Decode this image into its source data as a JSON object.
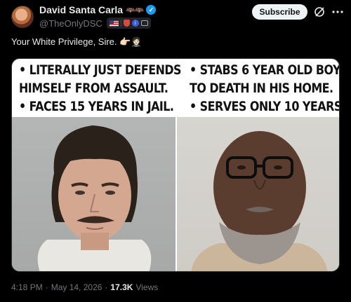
{
  "author": {
    "display_name": "David Santa Carla",
    "name_emoji": "🦇🦇",
    "handle": "@TheOnlyDSC"
  },
  "header": {
    "subscribe_label": "Subscribe",
    "grok_icon": "grok-icon",
    "more_icon": "more-icon"
  },
  "tweet": {
    "text": "Your White Privilege, Sire. 👉🏻🤵🏻"
  },
  "media": {
    "left_caption": [
      "• LITERALLY JUST DEFENDS",
      "HIMSELF FROM ASSAULT.",
      "• FACES 15 YEARS IN JAIL."
    ],
    "right_caption": [
      "• STABS 6 YEAR OLD BOY",
      "TO DEATH IN HIS HOME.",
      "• SERVES ONLY 10 YEARS."
    ],
    "left_photo": "mugshot-young-man-mustache",
    "right_photo": "mugshot-bald-man-glasses-beard"
  },
  "meta": {
    "time": "4:18 PM",
    "separator": "·",
    "date": "May 14, 2026",
    "separator2": "·",
    "views_count": "17.3K",
    "views_label": "Views"
  },
  "colors": {
    "background": "#000000",
    "text": "#e7e9ea",
    "secondary": "#71767b",
    "verified": "#1d9bf0"
  }
}
